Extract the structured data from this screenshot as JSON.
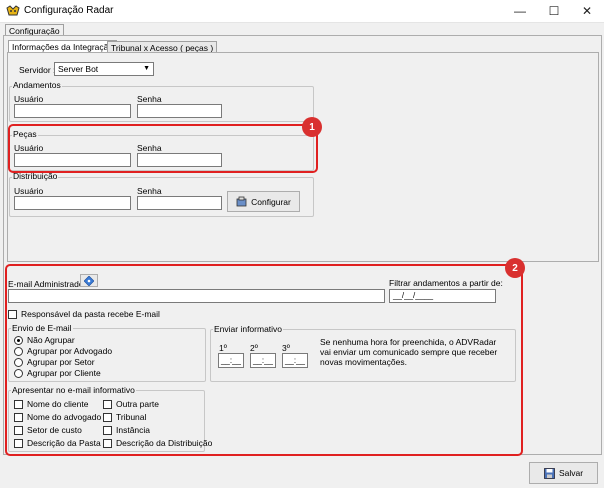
{
  "window": {
    "title": "Configuração Radar",
    "minimize": "—",
    "maximize": "☐",
    "close": "✕"
  },
  "top_tab": "Configuração",
  "tabs": [
    "Informações da Integração",
    "Tribunal x Acesso ( peças )"
  ],
  "servidor": {
    "label": "Servidor :",
    "value": "Server Bot"
  },
  "andamentos": {
    "legend": "Andamentos",
    "usuario": "Usuário",
    "senha": "Senha"
  },
  "pecas": {
    "legend": "Peças",
    "usuario": "Usuário",
    "senha": "Senha"
  },
  "distribuicao": {
    "legend": "Distribuição",
    "usuario": "Usuário",
    "senha": "Senha",
    "configurar": "Configurar"
  },
  "email": {
    "admin_label": "E-mail Administrador",
    "filtrar_label": "Filtrar andamentos a partir de:",
    "date_value": "__/__/____",
    "responsavel": "Responsável da pasta recebe E-mail"
  },
  "envio": {
    "legend": "Envio de E-mail",
    "options": [
      "Não Agrupar",
      "Agrupar por Advogado",
      "Agrupar por Setor",
      "Agrupar por Cliente"
    ],
    "selected": "Não Agrupar"
  },
  "informativo": {
    "legend": "Enviar informativo",
    "slots": [
      "1º",
      "2º",
      "3º"
    ],
    "time_value": "__:__",
    "note": "Se nenhuma hora for preenchida, o ADVRadar vai enviar um comunicado sempre que receber novas movimentações."
  },
  "apresentar": {
    "legend": "Apresentar no e-mail informativo",
    "col1": [
      "Nome do cliente",
      "Nome do advogado",
      "Setor de custo",
      "Descrição da Pasta"
    ],
    "col2": [
      "Outra parte",
      "Tribunal",
      "Instância",
      "Descrição da Distribuição"
    ]
  },
  "salvar": "Salvar",
  "annotations": [
    "1",
    "2"
  ],
  "colors": {
    "highlight": "#e02020",
    "badge": "#d9302f"
  }
}
